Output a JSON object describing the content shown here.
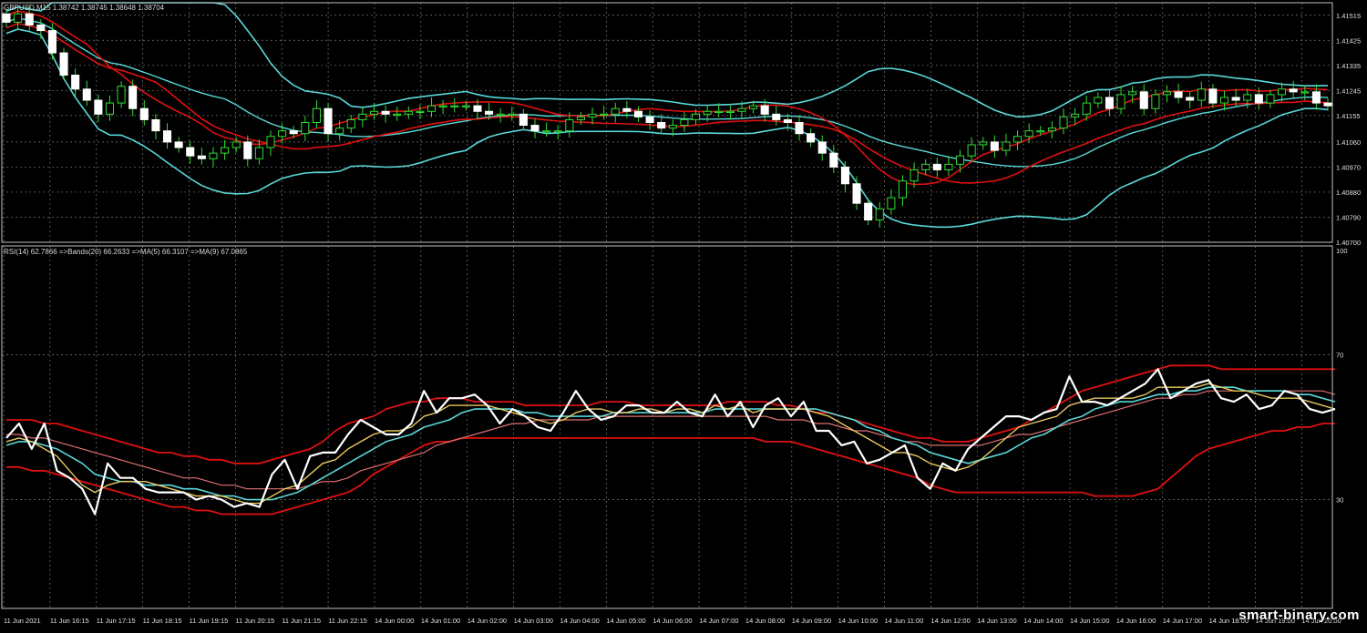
{
  "window": {
    "price_header": "GBPUSD,M15  1.38742  1.38745  1.38648  1.38704",
    "rsi_header": "RSI(14) 62.7866  =>Bands(20) 66.2633  =>MA(5) 66.3107  =>MA(9) 67.0865"
  },
  "watermark": "smart-binary.com",
  "colors": {
    "background": "#000000",
    "grid": "#7a7a7a",
    "bollinger": "#5ad8d8",
    "red_lines": "#e01010",
    "bull_candle": "#ffffff",
    "bear_candle": "#ffffff",
    "wick": "#33dd33",
    "rsi": "#ffffff",
    "rsi_ma5": "#e8c860",
    "rsi_ma9": "#5ad8d8",
    "rsi_ma_slow": "#e07070"
  },
  "chart_data": [
    {
      "type": "candlestick",
      "symbol": "GBPUSD",
      "timeframe": "M15",
      "ohlc_header": [
        1.38742,
        1.38745,
        1.38648,
        1.38704
      ],
      "ylim": [
        1.407,
        1.4156
      ],
      "y_tick_labels": [
        "1.41515",
        "1.41425",
        "1.41335",
        "1.41245",
        "1.41155",
        "1.41060",
        "1.40970",
        "1.40880",
        "1.40790",
        "1.40700"
      ],
      "x_tick_labels": [
        "11 Jun 2021",
        "11 Jun 16:15",
        "11 Jun 17:15",
        "11 Jun 18:15",
        "11 Jun 19:15",
        "11 Jun 20:15",
        "11 Jun 21:15",
        "11 Jun 22:15",
        "14 Jun 00:00",
        "14 Jun 01:00",
        "14 Jun 02:00",
        "14 Jun 03:00",
        "14 Jun 04:00",
        "14 Jun 05:00",
        "14 Jun 06:00",
        "14 Jun 07:00",
        "14 Jun 08:00",
        "14 Jun 09:00",
        "14 Jun 10:00",
        "14 Jun 11:00",
        "14 Jun 12:00",
        "14 Jun 13:00",
        "14 Jun 14:00",
        "14 Jun 15:00",
        "14 Jun 16:00",
        "14 Jun 17:00",
        "14 Jun 18:00",
        "14 Jun 19:00",
        "14 Jun 20:00"
      ],
      "grid": true,
      "series": [
        {
          "name": "close",
          "values": [
            1.4149,
            1.4152,
            1.4148,
            1.4146,
            1.4138,
            1.413,
            1.4125,
            1.4121,
            1.4116,
            1.412,
            1.4126,
            1.4118,
            1.4114,
            1.411,
            1.4106,
            1.4104,
            1.4101,
            1.41,
            1.4102,
            1.4104,
            1.4106,
            1.41,
            1.4104,
            1.4108,
            1.411,
            1.4109,
            1.4113,
            1.4118,
            1.4109,
            1.4111,
            1.4114,
            1.4116,
            1.4117,
            1.4116,
            1.4116,
            1.4117,
            1.4117,
            1.4119,
            1.4119,
            1.4119,
            1.4119,
            1.4117,
            1.4116,
            1.4116,
            1.4116,
            1.4112,
            1.411,
            1.411,
            1.411,
            1.4114,
            1.4115,
            1.4116,
            1.4116,
            1.4118,
            1.4117,
            1.4115,
            1.4113,
            1.4111,
            1.4112,
            1.4114,
            1.4116,
            1.4117,
            1.4117,
            1.4117,
            1.4118,
            1.4119,
            1.4116,
            1.4114,
            1.4113,
            1.4109,
            1.4106,
            1.4102,
            1.4097,
            1.4091,
            1.4084,
            1.4078,
            1.4082,
            1.4086,
            1.4092,
            1.4096,
            1.4098,
            1.4096,
            1.4098,
            1.4101,
            1.4105,
            1.4106,
            1.4103,
            1.4106,
            1.4108,
            1.411,
            1.411,
            1.4111,
            1.4115,
            1.4116,
            1.412,
            1.4122,
            1.4118,
            1.4123,
            1.4124,
            1.4118,
            1.4123,
            1.4124,
            1.4122,
            1.4121,
            1.4125,
            1.412,
            1.4122,
            1.4121,
            1.4123,
            1.412,
            1.4123,
            1.4125,
            1.4124,
            1.4124,
            1.412,
            1.4119
          ]
        }
      ]
    },
    {
      "type": "line",
      "name": "RSI(14)",
      "ylim": [
        0,
        100
      ],
      "y_tick_labels": [
        "100",
        "70",
        "30"
      ],
      "levels": [
        70,
        30
      ],
      "header_values": {
        "RSI(14)": 62.7866,
        "Bands(20)": 66.2633,
        "MA(5)": 66.3107,
        "MA(9)": 67.0865
      },
      "series": [
        {
          "name": "RSI(14)",
          "values": [
            47,
            51,
            44,
            51,
            38,
            36,
            33,
            26,
            40,
            36,
            36,
            33,
            32,
            32,
            32,
            30,
            31,
            30,
            28,
            29,
            28,
            37,
            41,
            33,
            42,
            43,
            43,
            48,
            52,
            50,
            48,
            48,
            51,
            60,
            54,
            58,
            58,
            59,
            56,
            51,
            55,
            53,
            50,
            49,
            54,
            60,
            55,
            52,
            53,
            56,
            56,
            54,
            54,
            57,
            54,
            53,
            59,
            53,
            57,
            50,
            56,
            58,
            53,
            57,
            49,
            49,
            45,
            46,
            40,
            41,
            43,
            45,
            36,
            33,
            40,
            38,
            44,
            47,
            50,
            53,
            53,
            52,
            54,
            55,
            64,
            57,
            57,
            56,
            58,
            60,
            62,
            66,
            58,
            60,
            62,
            63,
            58,
            57,
            59,
            55,
            56,
            60,
            59,
            55,
            54,
            55
          ]
        },
        {
          "name": "MA(5)",
          "values": [
            46,
            47,
            46,
            44,
            42,
            38,
            34,
            32,
            34,
            35,
            35,
            35,
            34,
            33,
            32,
            31,
            31,
            31,
            30,
            29,
            29,
            31,
            33,
            34,
            37,
            40,
            41,
            44,
            46,
            48,
            49,
            49,
            50,
            53,
            54,
            56,
            56,
            56,
            56,
            55,
            54,
            53,
            52,
            51,
            52,
            54,
            55,
            55,
            54,
            54,
            55,
            55,
            54,
            55,
            55,
            54,
            56,
            55,
            56,
            54,
            55,
            55,
            55,
            55,
            54,
            53,
            51,
            49,
            47,
            45,
            43,
            43,
            42,
            40,
            39,
            38,
            39,
            41,
            44,
            47,
            50,
            51,
            52,
            53,
            56,
            57,
            58,
            58,
            58,
            58,
            59,
            61,
            61,
            61,
            61,
            62,
            61,
            60,
            60,
            59,
            58,
            58,
            58,
            57,
            56,
            55
          ]
        },
        {
          "name": "MA(9)",
          "values": [
            45,
            46,
            46,
            45,
            44,
            42,
            40,
            37,
            36,
            35,
            35,
            34,
            34,
            34,
            33,
            33,
            32,
            31,
            31,
            30,
            30,
            30,
            31,
            32,
            34,
            36,
            38,
            40,
            42,
            44,
            46,
            47,
            48,
            50,
            51,
            52,
            54,
            55,
            55,
            55,
            55,
            54,
            54,
            53,
            53,
            53,
            53,
            53,
            54,
            54,
            54,
            54,
            54,
            54,
            54,
            54,
            55,
            55,
            55,
            55,
            55,
            55,
            55,
            55,
            55,
            54,
            53,
            52,
            50,
            49,
            47,
            46,
            45,
            43,
            42,
            41,
            40,
            41,
            42,
            43,
            45,
            47,
            48,
            50,
            52,
            53,
            55,
            56,
            57,
            57,
            58,
            59,
            59,
            60,
            60,
            61,
            61,
            61,
            60,
            60,
            60,
            60,
            59,
            59,
            58,
            57
          ]
        },
        {
          "name": "MA(slow)",
          "values": [
            48,
            48,
            47,
            47,
            46,
            45,
            44,
            43,
            42,
            41,
            40,
            39,
            38,
            37,
            36,
            36,
            35,
            34,
            34,
            33,
            33,
            33,
            33,
            33,
            34,
            35,
            35,
            36,
            38,
            39,
            40,
            41,
            42,
            43,
            45,
            46,
            47,
            48,
            49,
            50,
            51,
            51,
            52,
            52,
            52,
            52,
            52,
            53,
            53,
            53,
            53,
            53,
            53,
            53,
            53,
            53,
            53,
            53,
            53,
            53,
            53,
            52,
            52,
            52,
            51,
            51,
            50,
            49,
            49,
            48,
            47,
            46,
            46,
            45,
            45,
            45,
            45,
            45,
            46,
            47,
            48,
            48,
            49,
            50,
            51,
            52,
            53,
            54,
            55,
            56,
            57,
            58,
            58,
            59,
            59,
            60,
            60,
            60,
            60,
            60,
            60,
            60,
            60,
            60,
            60,
            59
          ]
        },
        {
          "name": "Bands upper",
          "values": [
            52,
            52,
            52,
            51,
            51,
            50,
            49,
            48,
            47,
            46,
            45,
            44,
            43,
            43,
            42,
            42,
            41,
            41,
            40,
            40,
            40,
            41,
            42,
            43,
            44,
            46,
            49,
            51,
            52,
            53,
            55,
            56,
            57,
            57,
            58,
            58,
            58,
            57,
            57,
            57,
            57,
            56,
            56,
            56,
            56,
            56,
            56,
            57,
            57,
            57,
            56,
            56,
            56,
            56,
            56,
            56,
            56,
            57,
            57,
            57,
            57,
            56,
            56,
            55,
            54,
            54,
            53,
            52,
            51,
            50,
            49,
            48,
            47,
            47,
            46,
            46,
            46,
            47,
            48,
            49,
            50,
            52,
            54,
            56,
            58,
            60,
            61,
            62,
            63,
            64,
            65,
            66,
            67,
            67,
            67,
            67,
            66,
            66,
            66,
            66,
            66,
            66,
            66,
            66,
            66,
            66
          ]
        },
        {
          "name": "Bands lower",
          "values": [
            39,
            39,
            38,
            38,
            37,
            36,
            35,
            34,
            33,
            32,
            31,
            30,
            29,
            28,
            28,
            27,
            27,
            26,
            26,
            26,
            26,
            26,
            27,
            28,
            29,
            30,
            31,
            32,
            34,
            37,
            39,
            41,
            43,
            45,
            46,
            46,
            47,
            47,
            47,
            47,
            47,
            47,
            47,
            47,
            47,
            47,
            47,
            47,
            47,
            47,
            47,
            47,
            47,
            47,
            47,
            47,
            47,
            47,
            47,
            47,
            46,
            46,
            46,
            45,
            44,
            43,
            42,
            41,
            40,
            39,
            38,
            37,
            36,
            34,
            33,
            32,
            32,
            32,
            32,
            32,
            32,
            32,
            32,
            32,
            32,
            32,
            31,
            31,
            31,
            31,
            32,
            33,
            36,
            39,
            42,
            44,
            45,
            46,
            47,
            48,
            49,
            49,
            50,
            50,
            51,
            51
          ]
        }
      ]
    }
  ]
}
